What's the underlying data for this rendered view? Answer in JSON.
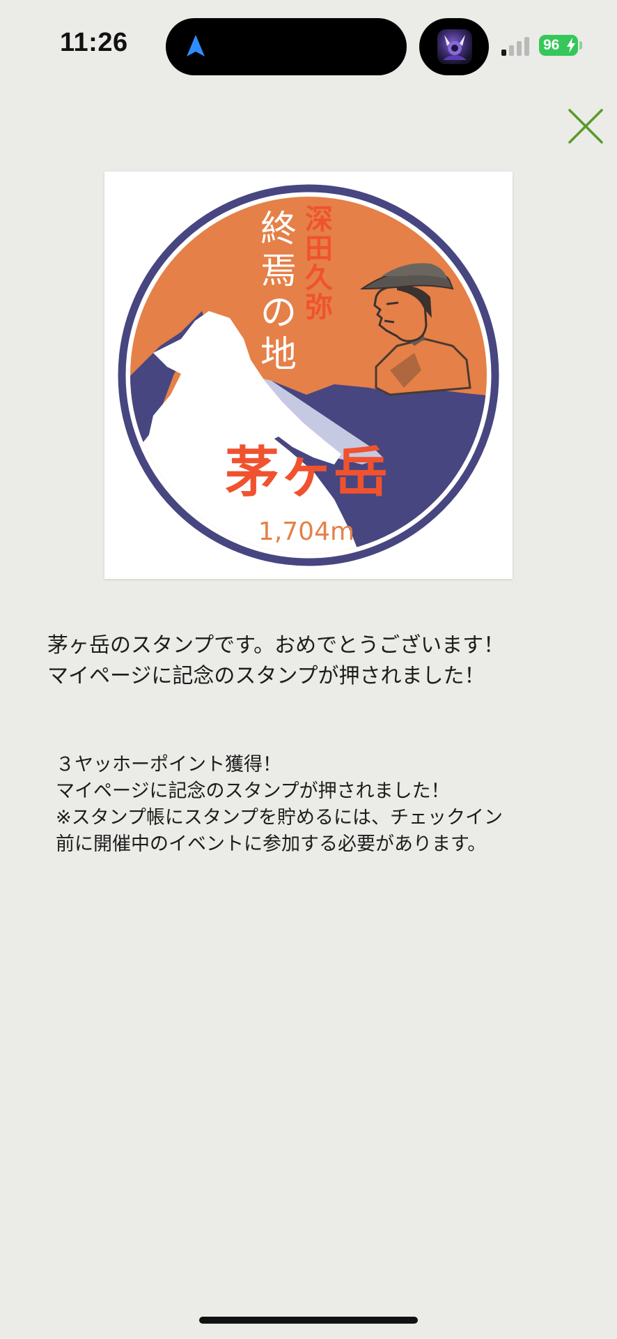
{
  "status_bar": {
    "time": "11:26",
    "battery": "96",
    "icons": [
      "navigation-arrow-icon",
      "live-activity-thumbnail",
      "cellular-signal-icon",
      "battery-charging-icon"
    ]
  },
  "close_button": {
    "icon": "close-icon"
  },
  "stamp": {
    "vertical_name": [
      "深",
      "田",
      "久",
      "弥"
    ],
    "vertical_phrase": [
      "終",
      "焉",
      "の",
      "地"
    ],
    "mountain_name": "茅ヶ岳",
    "elevation": "1,704m"
  },
  "message": {
    "line1": "茅ヶ岳のスタンプです。おめでとうございます！",
    "line2": "マイページに記念のスタンプが押されました！"
  },
  "reward": {
    "line1": "３ヤッホーポイント獲得！",
    "line2": "マイページに記念のスタンプが押されました！",
    "line3": "※スタンプ帳にスタンプを貯めるには、チェックイン",
    "line4": "前に開催中のイベントに参加する必要があります。"
  },
  "colors": {
    "background": "#ebebe7",
    "accent_green": "#5a9a2a",
    "stamp_orange": "#e58048",
    "stamp_navy": "#474680",
    "stamp_red": "#f0522f",
    "battery_green": "#35c759"
  }
}
